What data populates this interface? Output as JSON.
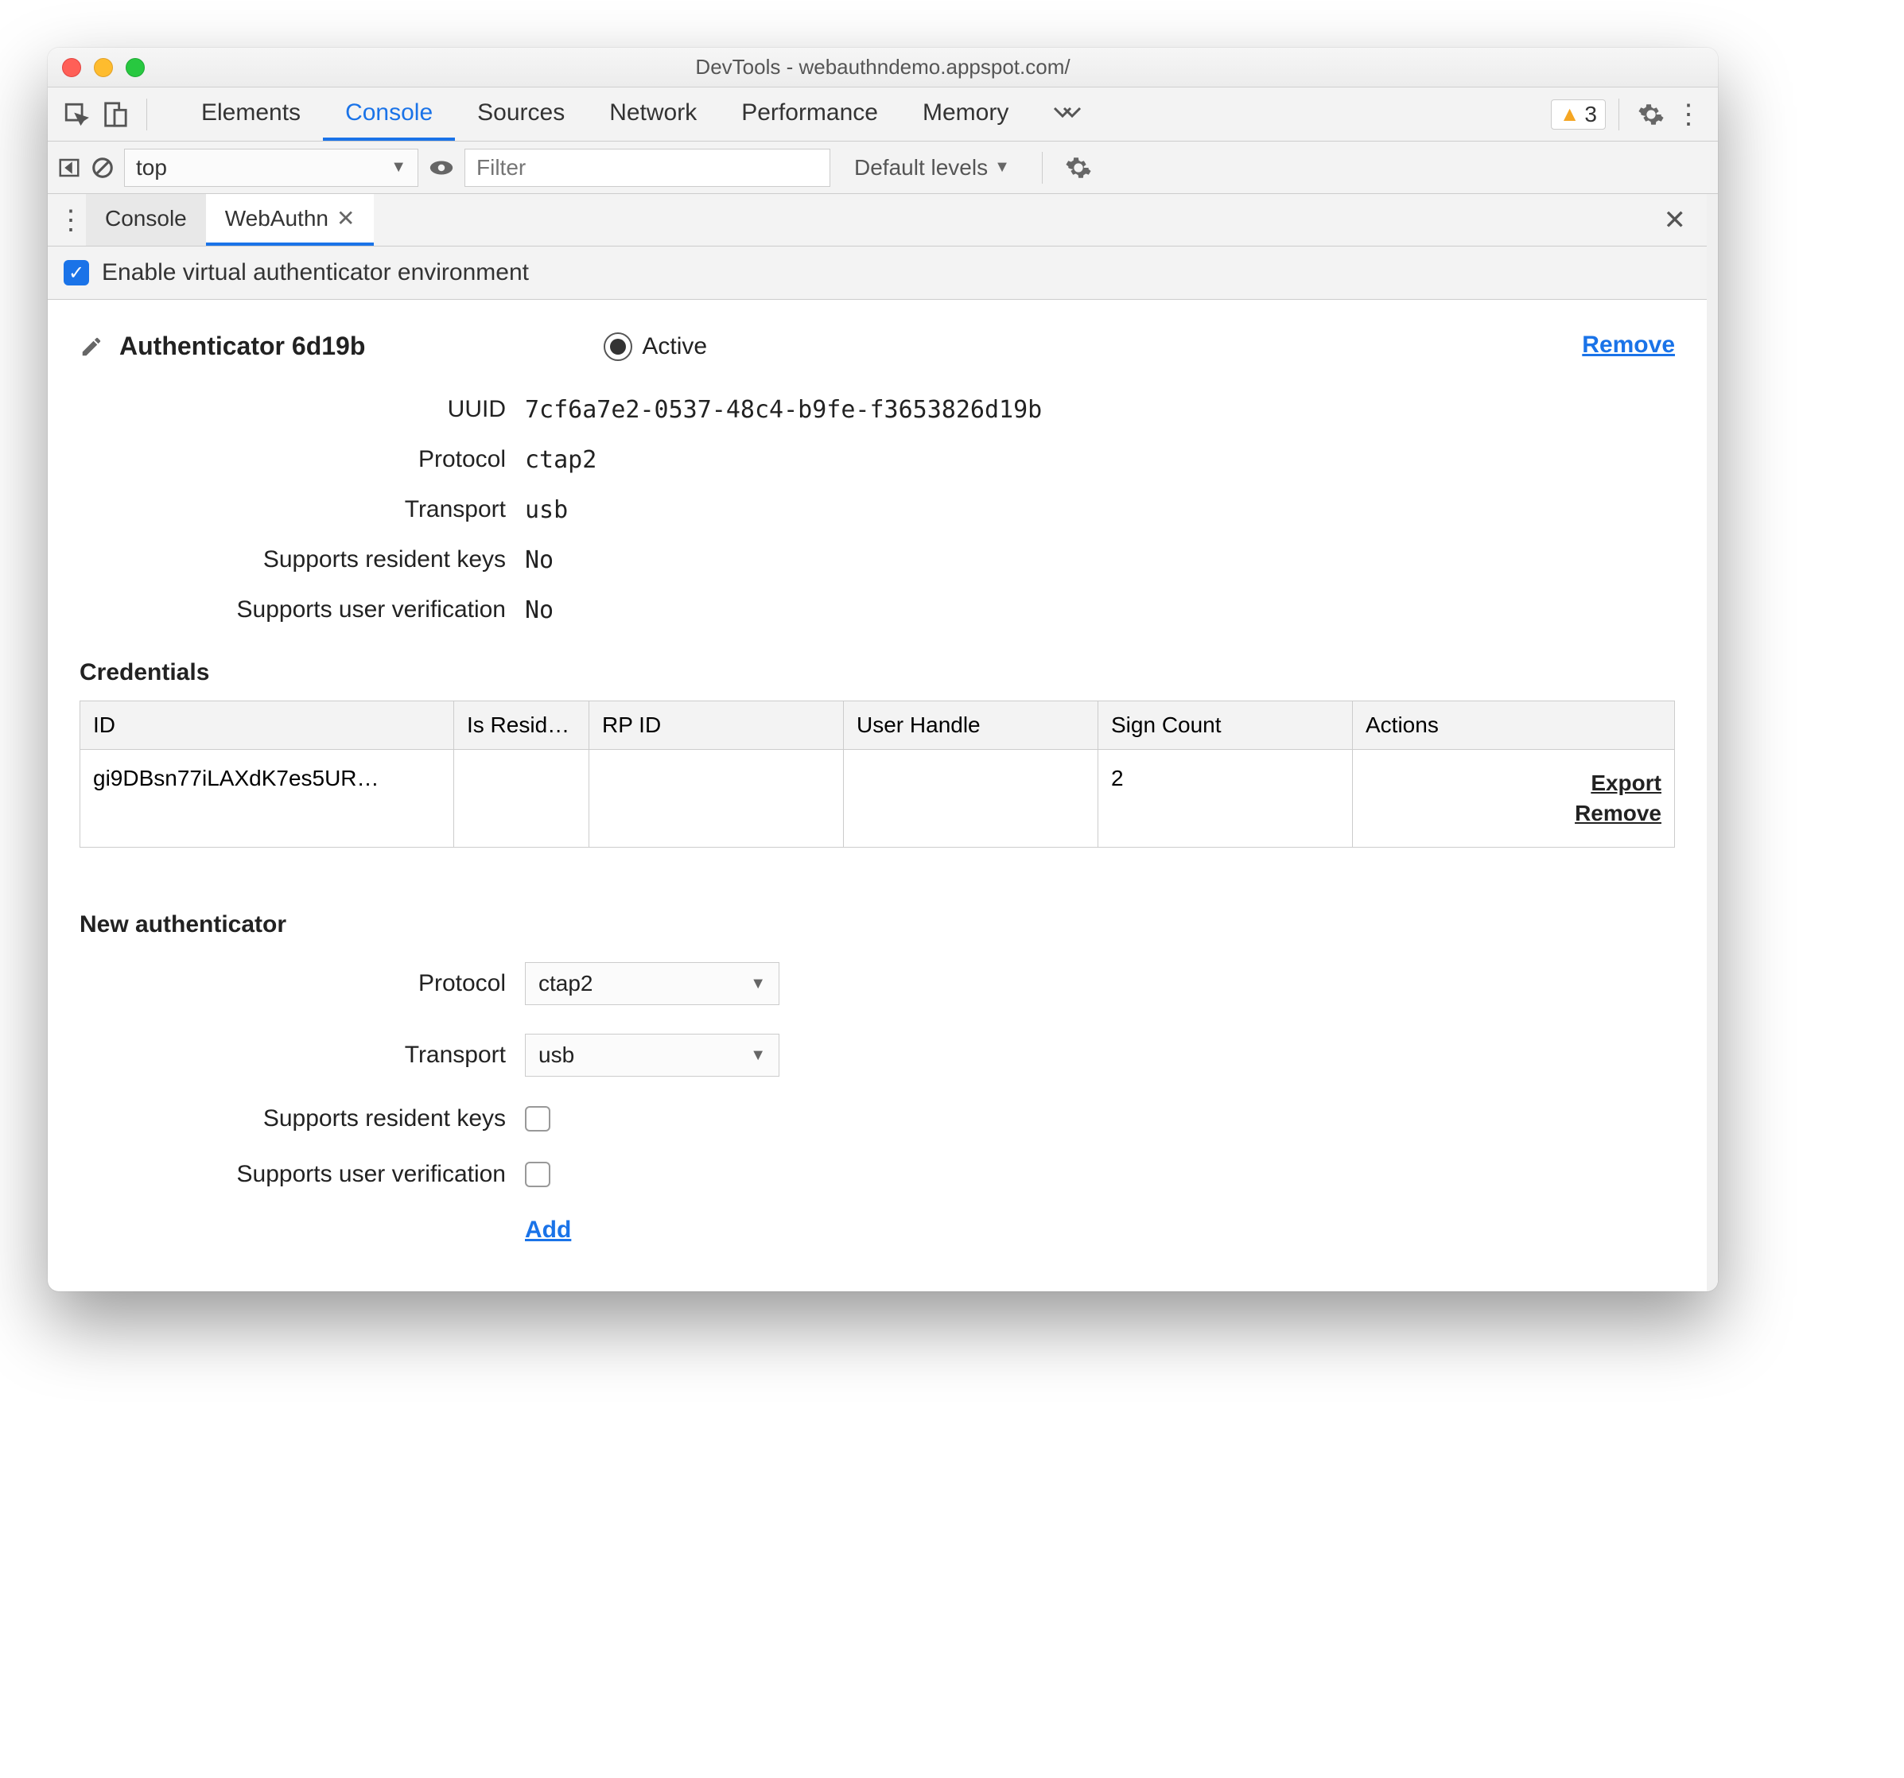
{
  "window": {
    "title": "DevTools - webauthndemo.appspot.com/"
  },
  "main_tabs": {
    "items": [
      "Elements",
      "Console",
      "Sources",
      "Network",
      "Performance",
      "Memory"
    ],
    "active_index": 1,
    "warning_count": "3"
  },
  "console_bar": {
    "context": "top",
    "filter_placeholder": "Filter",
    "levels_label": "Default levels"
  },
  "drawer_tabs": {
    "items": [
      "Console",
      "WebAuthn"
    ],
    "active_index": 1
  },
  "enable": {
    "label": "Enable virtual authenticator environment",
    "checked": true
  },
  "authenticator": {
    "title": "Authenticator 6d19b",
    "active_label": "Active",
    "remove_label": "Remove",
    "fields": {
      "uuid_label": "UUID",
      "uuid_value": "7cf6a7e2-0537-48c4-b9fe-f3653826d19b",
      "protocol_label": "Protocol",
      "protocol_value": "ctap2",
      "transport_label": "Transport",
      "transport_value": "usb",
      "resident_label": "Supports resident keys",
      "resident_value": "No",
      "userverif_label": "Supports user verification",
      "userverif_value": "No"
    }
  },
  "credentials": {
    "title": "Credentials",
    "headers": {
      "id": "ID",
      "is_resident": "Is Resid…",
      "rp_id": "RP ID",
      "user_handle": "User Handle",
      "sign_count": "Sign Count",
      "actions": "Actions"
    },
    "rows": [
      {
        "id": "gi9DBsn77iLAXdK7es5UR…",
        "is_resident": "",
        "rp_id": "",
        "user_handle": "",
        "sign_count": "2",
        "export_label": "Export",
        "remove_label": "Remove"
      }
    ]
  },
  "new_auth": {
    "title": "New authenticator",
    "protocol_label": "Protocol",
    "protocol_value": "ctap2",
    "transport_label": "Transport",
    "transport_value": "usb",
    "resident_label": "Supports resident keys",
    "userverif_label": "Supports user verification",
    "add_label": "Add"
  }
}
